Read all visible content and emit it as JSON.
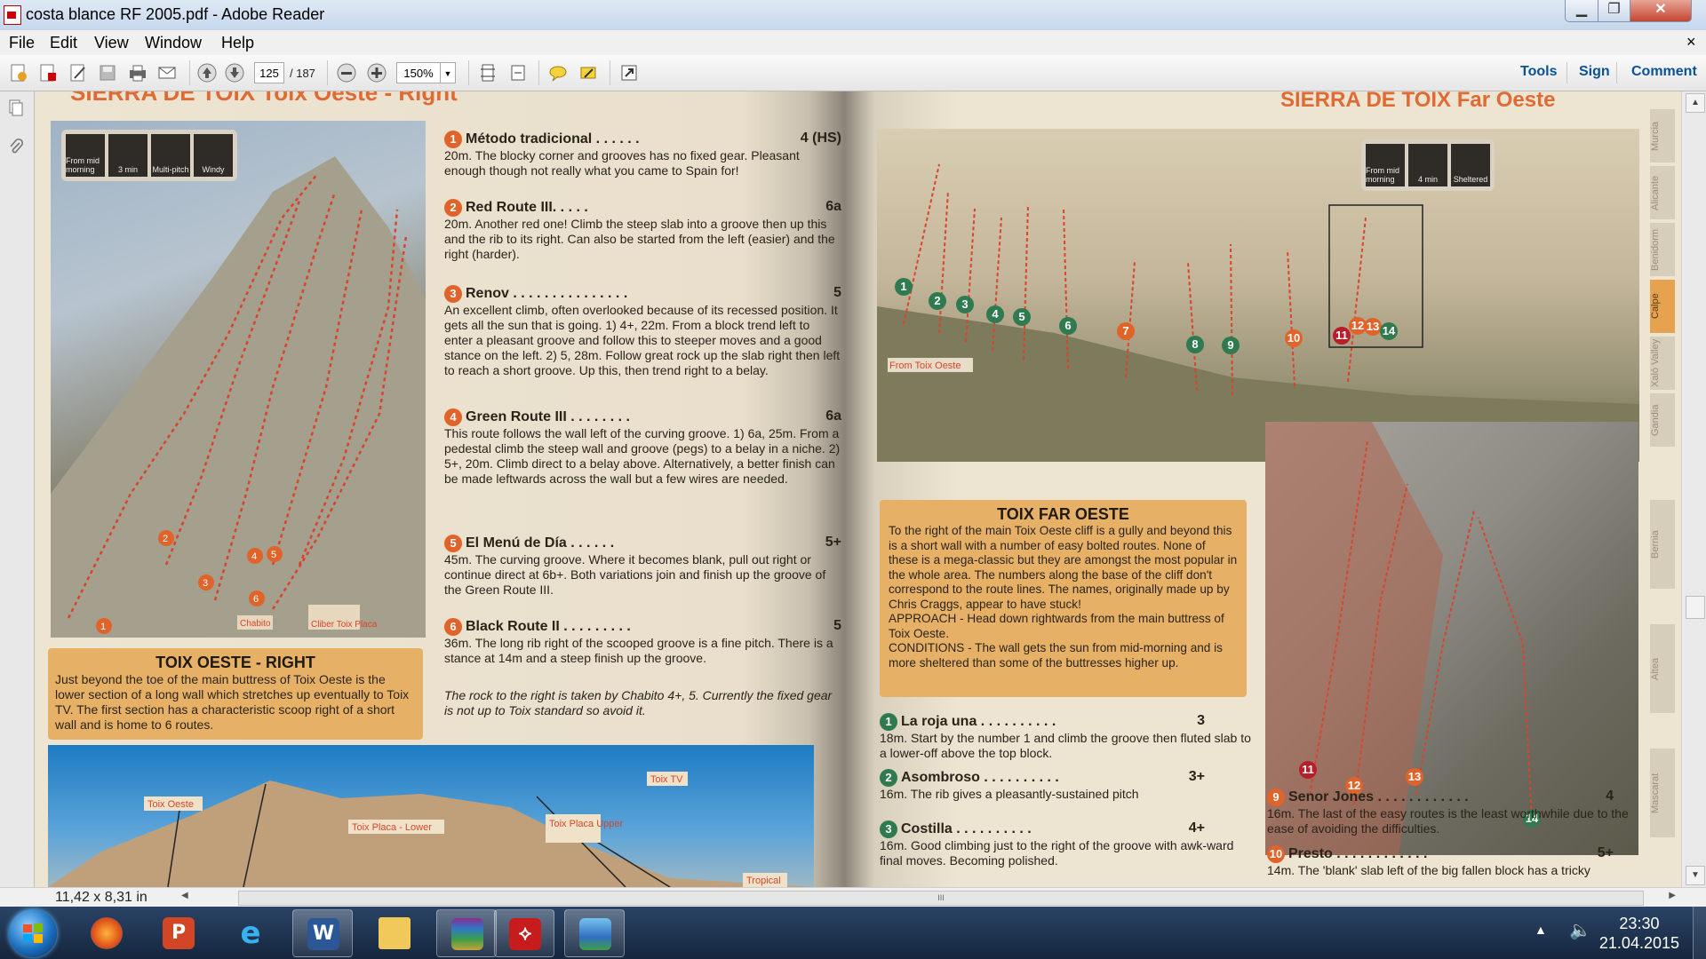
{
  "window": {
    "title": "costa blance RF 2005.pdf - Adobe Reader",
    "min_symbol": "▁",
    "max_symbol": "❐",
    "close_symbol": "✕"
  },
  "menu": {
    "items": [
      "File",
      "Edit",
      "View",
      "Window",
      "Help"
    ],
    "close_symbol": "×"
  },
  "toolbar": {
    "page_current": "125",
    "page_total": "/ 187",
    "zoom": "150%",
    "right_links": [
      "Tools",
      "Sign",
      "Comment"
    ],
    "icons": [
      "create-pdf-icon",
      "convert-pdf-icon",
      "edit-icon",
      "save-icon",
      "print-icon",
      "email-icon",
      "prev-page-icon",
      "next-page-icon",
      "zoom-out-icon",
      "zoom-in-icon",
      "fit-page-icon",
      "fit-width-icon",
      "comment-icon",
      "highlight-icon",
      "fullscreen-icon"
    ]
  },
  "status": {
    "dimensions": "11,42 x 8,31 in",
    "scroll_thumb": "III"
  },
  "taskbar": {
    "apps": [
      "firefox",
      "powerpoint",
      "internet-explorer",
      "word",
      "explorer",
      "winrar",
      "acrobat",
      "photos"
    ],
    "time": "23:30",
    "date": "21.04.2015"
  },
  "page": {
    "left_heading": "SIERRA DE TOIX  Toix Oeste - Right",
    "right_heading": "SIERRA DE TOIX  Far Oeste",
    "left_icons": [
      "From mid morning",
      "3 min",
      "Multi-pitch",
      "Windy"
    ],
    "right_icons": [
      "From mid morning",
      "4 min",
      "Sheltered"
    ],
    "side_tabs": [
      "Murcia",
      "Alicante",
      "Benidorm",
      "Calpe",
      "Xaló Valley",
      "Gandia",
      "Bernia",
      "Altea",
      "Mascarat"
    ],
    "left_routes": [
      {
        "n": "1",
        "name": "Método tradicional . . . . . .",
        "grade": "4 (HS)",
        "text": "20m. The blocky corner and grooves has no fixed gear. Pleasant enough though not really what you came to Spain for!"
      },
      {
        "n": "2",
        "name": "Red Route III. . . . .",
        "grade": "6a",
        "text": "20m. Another red one! Climb the steep slab into a groove then up this and the rib to its right. Can also be started from the left (easier) and the right (harder)."
      },
      {
        "n": "3",
        "name": "Renov . . . . . . . . . . . . . . .",
        "grade": "5",
        "text": "An excellent climb, often overlooked because of its recessed position. It gets all the sun that is going. 1) 4+, 22m. From a block trend left to enter a pleasant groove and follow this to steeper moves and a good stance on the left. 2) 5, 28m. Follow great rock up the slab right then left to reach a short groove. Up this, then trend right to a belay."
      },
      {
        "n": "4",
        "name": "Green Route III . . . . . . . .",
        "grade": "6a",
        "text": "This route follows the wall left of the curving groove. 1) 6a, 25m. From a pedestal climb the steep wall and groove (pegs) to a belay in a niche. 2) 5+, 20m. Climb direct to a belay above. Alternatively, a better finish can be made leftwards across the wall but a few wires are needed."
      },
      {
        "n": "5",
        "name": "El Menú de Día . . . . . .",
        "grade": "5+",
        "text": "45m. The curving groove. Where it becomes blank, pull out right or continue direct at 6b+. Both variations join and finish up the groove of the Green Route III."
      },
      {
        "n": "6",
        "name": "Black Route II . . . . . . . . .",
        "grade": "5",
        "text": "36m. The long rib right of the scooped groove is a fine pitch. There is a stance at 14m and a steep finish up the groove."
      }
    ],
    "left_note": "The rock to the right is taken by Chabito 4+, 5. Currently the fixed gear is not up to Toix standard so avoid it.",
    "left_box_title": "TOIX OESTE - RIGHT",
    "left_box_text": "Just beyond the toe of the main buttress of Toix Oeste is the lower section of a long wall which stretches up eventually to Toix TV. The first section has a characteristic scoop right of a short wall and is home to 6 routes.",
    "left_photo_labels": [
      "Chabito",
      "Cliber Toix Placa"
    ],
    "map_labels": [
      "Toix Oeste",
      "Toix Placa - Lower",
      "Toix Placa Upper",
      "Toix TV",
      "Tropical"
    ],
    "right_box_title": "TOIX FAR OESTE",
    "right_box_text": "To the right of the main Toix Oeste cliff is a gully and beyond this is a short wall with a number of easy bolted routes. None of these is a mega-classic but they are amongst the most popular in the whole area. The numbers along the base of the cliff don't correspond to the route lines. The names, originally made up by Chris Craggs, appear to have stuck!",
    "right_box_approach": "APPROACH - Head down rightwards from the main buttress of Toix Oeste.",
    "right_box_conditions": "CONDITIONS - The wall gets the sun from mid-morning and is more sheltered than some of the buttresses higher up.",
    "right_photo_label": "From Toix Oeste",
    "right_routes": [
      {
        "n": "1",
        "name": "La roja una . . . . . . . . . .",
        "grade": "3",
        "text": "18m. Start by the number 1 and climb the groove then fluted slab to a lower-off above the top block."
      },
      {
        "n": "2",
        "name": "Asombroso . . . . . . . . . .",
        "grade": "3+",
        "text": "16m. The rib gives a pleasantly-sustained pitch"
      },
      {
        "n": "3",
        "name": "Costilla . . . . . . . . . .",
        "grade": "4+",
        "text": "16m. Good climbing just to the right of the groove with awk-ward final moves. Becoming polished."
      }
    ],
    "right_routes_b": [
      {
        "n": "9",
        "name": "Senor Jones . . . . . . . . . . . .",
        "grade": "4",
        "text": "16m. The last of the easy routes is the least worthwhile due to the ease of avoiding the difficulties."
      },
      {
        "n": "10",
        "name": "Presto . . . . . . . . . . . .",
        "grade": "5+",
        "text": "14m. The 'blank' slab left of the big fallen block has a tricky"
      }
    ],
    "photo_numbers_top": [
      "1",
      "2",
      "3",
      "4",
      "5",
      "6",
      "7",
      "8",
      "9",
      "10",
      "11",
      "12",
      "13",
      "14"
    ],
    "photo_numbers_inset": [
      "11",
      "12",
      "13",
      "14"
    ],
    "photo_numbers_left": [
      "1",
      "2",
      "3",
      "4",
      "5",
      "6"
    ]
  }
}
